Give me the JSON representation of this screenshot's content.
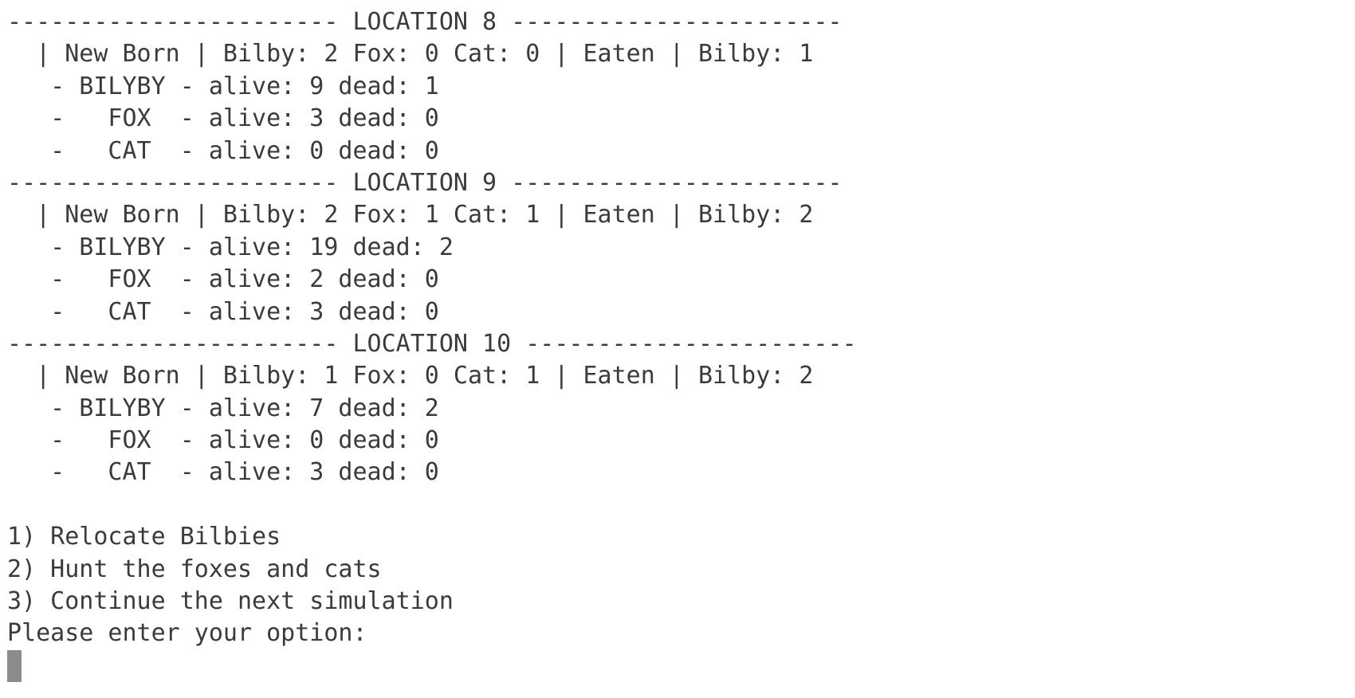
{
  "terminal": {
    "locations": [
      {
        "header": "----------------------- LOCATION 8 -----------------------",
        "summary": "  | New Born | Bilby: 2 Fox: 0 Cat: 0 | Eaten | Bilby: 1",
        "rows": [
          "   - BILYBY - alive: 9 dead: 1",
          "   -   FOX  - alive: 3 dead: 0",
          "   -   CAT  - alive: 0 dead: 0"
        ]
      },
      {
        "header": "----------------------- LOCATION 9 -----------------------",
        "summary": "  | New Born | Bilby: 2 Fox: 1 Cat: 1 | Eaten | Bilby: 2",
        "rows": [
          "   - BILYBY - alive: 19 dead: 2",
          "   -   FOX  - alive: 2 dead: 0",
          "   -   CAT  - alive: 3 dead: 0"
        ]
      },
      {
        "header": "----------------------- LOCATION 10 -----------------------",
        "summary": "  | New Born | Bilby: 1 Fox: 0 Cat: 1 | Eaten | Bilby: 2",
        "rows": [
          "   - BILYBY - alive: 7 dead: 2",
          "   -   FOX  - alive: 0 dead: 0",
          "   -   CAT  - alive: 3 dead: 0"
        ]
      }
    ],
    "menu": [
      "1) Relocate Bilbies",
      "2) Hunt the foxes and cats",
      "3) Continue the next simulation"
    ],
    "prompt": "Please enter your option:"
  }
}
